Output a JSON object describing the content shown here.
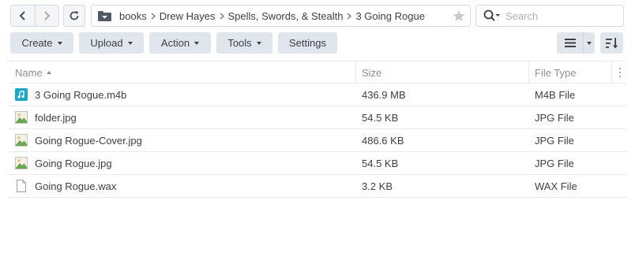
{
  "breadcrumb": [
    "books",
    "Drew Hayes",
    "Spells, Swords, & Stealth",
    "3 Going Rogue"
  ],
  "search": {
    "placeholder": "Search"
  },
  "toolbar": {
    "create_label": "Create",
    "upload_label": "Upload",
    "action_label": "Action",
    "tools_label": "Tools",
    "settings_label": "Settings"
  },
  "columns": {
    "name": "Name",
    "size": "Size",
    "type": "File Type"
  },
  "files": [
    {
      "name": "3 Going Rogue.m4b",
      "size": "436.9 MB",
      "type": "M4B File",
      "icon": "audio-file-icon"
    },
    {
      "name": "folder.jpg",
      "size": "54.5 KB",
      "type": "JPG File",
      "icon": "image-file-icon"
    },
    {
      "name": "Going Rogue-Cover.jpg",
      "size": "486.6 KB",
      "type": "JPG File",
      "icon": "image-file-icon"
    },
    {
      "name": "Going Rogue.jpg",
      "size": "54.5 KB",
      "type": "JPG File",
      "icon": "image-file-icon"
    },
    {
      "name": "Going Rogue.wax",
      "size": "3.2 KB",
      "type": "WAX File",
      "icon": "generic-file-icon"
    }
  ],
  "colors": {
    "accent_audio": "#1aa9c4",
    "image_green": "#6aa84f",
    "image_tan": "#d9c38a"
  }
}
